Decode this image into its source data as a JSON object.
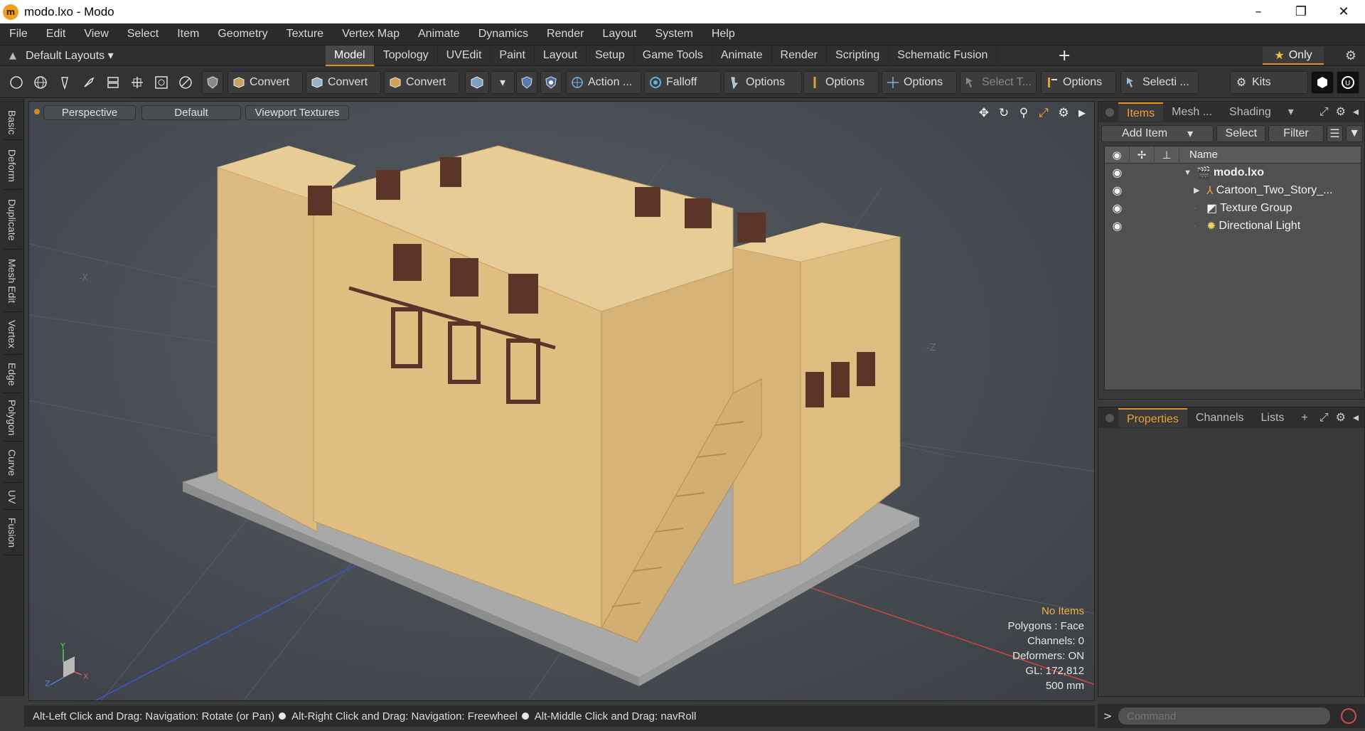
{
  "window": {
    "title": "modo.lxo - Modo",
    "icon": "modo-app-icon",
    "minimize": "–",
    "maximize": "❐",
    "close": "✕"
  },
  "menubar": [
    "File",
    "Edit",
    "View",
    "Select",
    "Item",
    "Geometry",
    "Texture",
    "Vertex Map",
    "Animate",
    "Dynamics",
    "Render",
    "Layout",
    "System",
    "Help"
  ],
  "tabrow": {
    "layouts": "Default Layouts ▾",
    "tabs": [
      "Model",
      "Topology",
      "UVEdit",
      "Paint",
      "Layout",
      "Setup",
      "Game Tools",
      "Animate",
      "Render",
      "Scripting",
      "Schematic Fusion"
    ],
    "active_tab": "Model",
    "plus": "+",
    "only": "Only"
  },
  "toolbar": {
    "convert1": "Convert",
    "convert2": "Convert",
    "convert3": "Convert",
    "action": "Action ...",
    "falloff": "Falloff",
    "options1": "Options",
    "options2": "Options",
    "options3": "Options",
    "options4": "Options",
    "select_t": "Select T...",
    "selecti": "Selecti ...",
    "kits": "Kits"
  },
  "lefttabs": [
    "Basic",
    "Deform",
    "Duplicate",
    "Mesh Edit",
    "Vertex",
    "Edge",
    "Polygon",
    "Curve",
    "UV",
    "Fusion"
  ],
  "viewport": {
    "perspective": "Perspective",
    "default": "Default",
    "textures": "Viewport Textures",
    "axis_x_label": "-X",
    "axis_z_label": "-Z",
    "gizmo_y": "Y",
    "gizmo_x": "X",
    "gizmo_z": "Z",
    "info": {
      "no_items": "No Items",
      "polygons": "Polygons : Face",
      "channels": "Channels: 0",
      "deformers": "Deformers: ON",
      "gl": "GL: 172,812",
      "scale": "500 mm"
    }
  },
  "statusbar": {
    "hint1": "Alt-Left Click and Drag: Navigation: Rotate (or Pan)",
    "hint2": "Alt-Right Click and Drag: Navigation: Freewheel",
    "hint3": "Alt-Middle Click and Drag: navRoll"
  },
  "items_panel": {
    "tabs": [
      "Items",
      "Mesh ...",
      "Shading"
    ],
    "add_item": "Add Item",
    "select": "Select",
    "filter": "Filter",
    "name_header": "Name",
    "rows": [
      {
        "label": "modo.lxo",
        "bold": true
      },
      {
        "label": "Cartoon_Two_Story_..."
      },
      {
        "label": "Texture Group"
      },
      {
        "label": "Directional Light"
      }
    ]
  },
  "props_panel": {
    "tabs": [
      "Properties",
      "Channels",
      "Lists"
    ],
    "plus": "+"
  },
  "command": {
    "prompt": ">",
    "placeholder": "Command"
  },
  "colors": {
    "accent": "#e09020",
    "building": "#e4c080",
    "floor": "#a8a8a8"
  }
}
